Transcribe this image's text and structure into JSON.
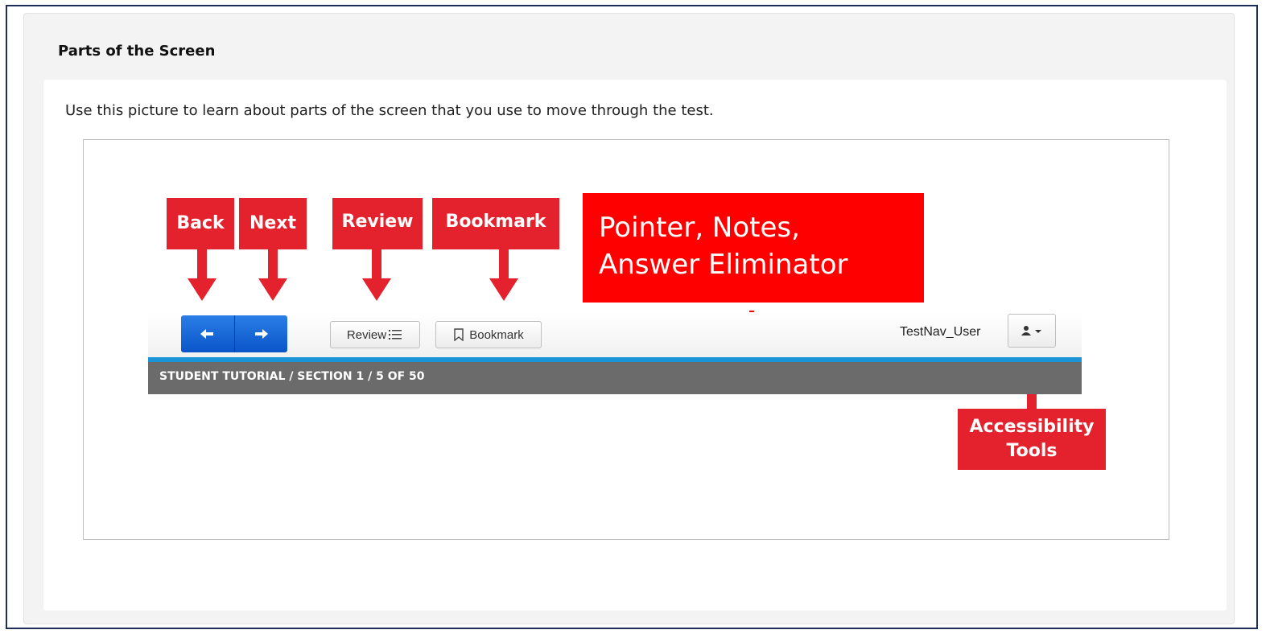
{
  "panel": {
    "title": "Parts of the Screen"
  },
  "intro": "Use this picture to learn about parts of the screen that you use to move through the test.",
  "callouts": {
    "back": "Back",
    "next": "Next",
    "review": "Review",
    "bookmark": "Bookmark",
    "pointer_line1": "Pointer, Notes,",
    "pointer_line2": "Answer Eliminator",
    "access_line1": "Accessibility",
    "access_line2": "Tools"
  },
  "toolbar": {
    "back_icon": "arrow-left-icon",
    "next_icon": "arrow-right-icon",
    "review_label": "Review",
    "bookmark_label": "Bookmark",
    "user_name": "TestNav_User",
    "user_icon": "user-icon"
  },
  "breadcrumb": "STUDENT TUTORIAL  /  SECTION 1  / 5 OF 50",
  "colors": {
    "callout_red": "#e3222d",
    "nav_blue": "#0a55c9",
    "progress_blue": "#1b94d8",
    "breadcrumb_gray": "#6b6b6b"
  }
}
